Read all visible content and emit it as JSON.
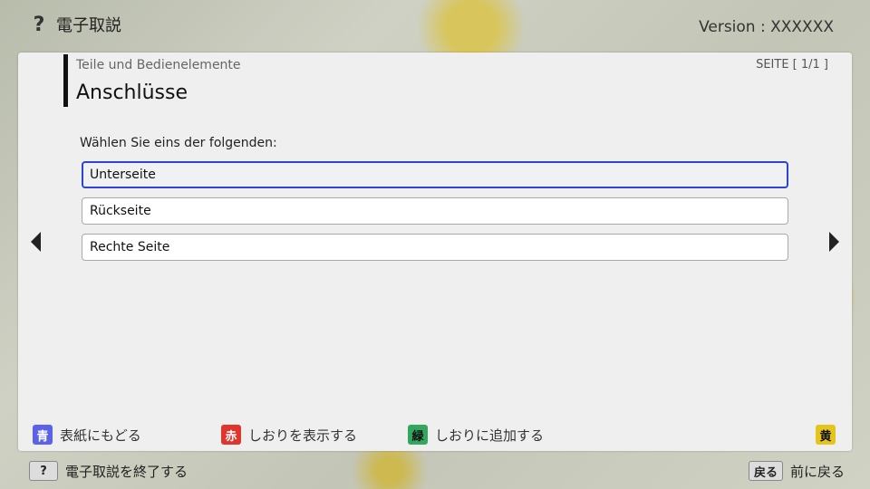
{
  "header": {
    "help_icon": "question-icon",
    "help_glyph": "?",
    "app_title": "電子取説",
    "version": "Version : XXXXXX"
  },
  "panel": {
    "category": "Teile und Bedienelemente",
    "title": "Anschlüsse",
    "page_indicator": "SEITE [ 1/1 ]",
    "prompt": "Wählen Sie eins der folgenden:",
    "options": [
      {
        "label": "Unterseite",
        "selected": true
      },
      {
        "label": "Rückseite",
        "selected": false
      },
      {
        "label": "Rechte Seite",
        "selected": false
      }
    ],
    "selection_color": "#2b44d6"
  },
  "footer": {
    "blue": {
      "key": "青",
      "label": "表紙にもどる",
      "color": "#5b62e8"
    },
    "red": {
      "key": "赤",
      "label": "しおりを表示する",
      "color": "#e0352c"
    },
    "green": {
      "key": "緑",
      "label": "しおりに追加する",
      "color": "#33a760"
    },
    "yellow": {
      "key": "黄",
      "label": "",
      "color": "#e5c51c"
    }
  },
  "bottom": {
    "help_key": "?",
    "exit_label": "電子取説を終了する",
    "back_key": "戻る",
    "back_label": "前に戻る"
  }
}
